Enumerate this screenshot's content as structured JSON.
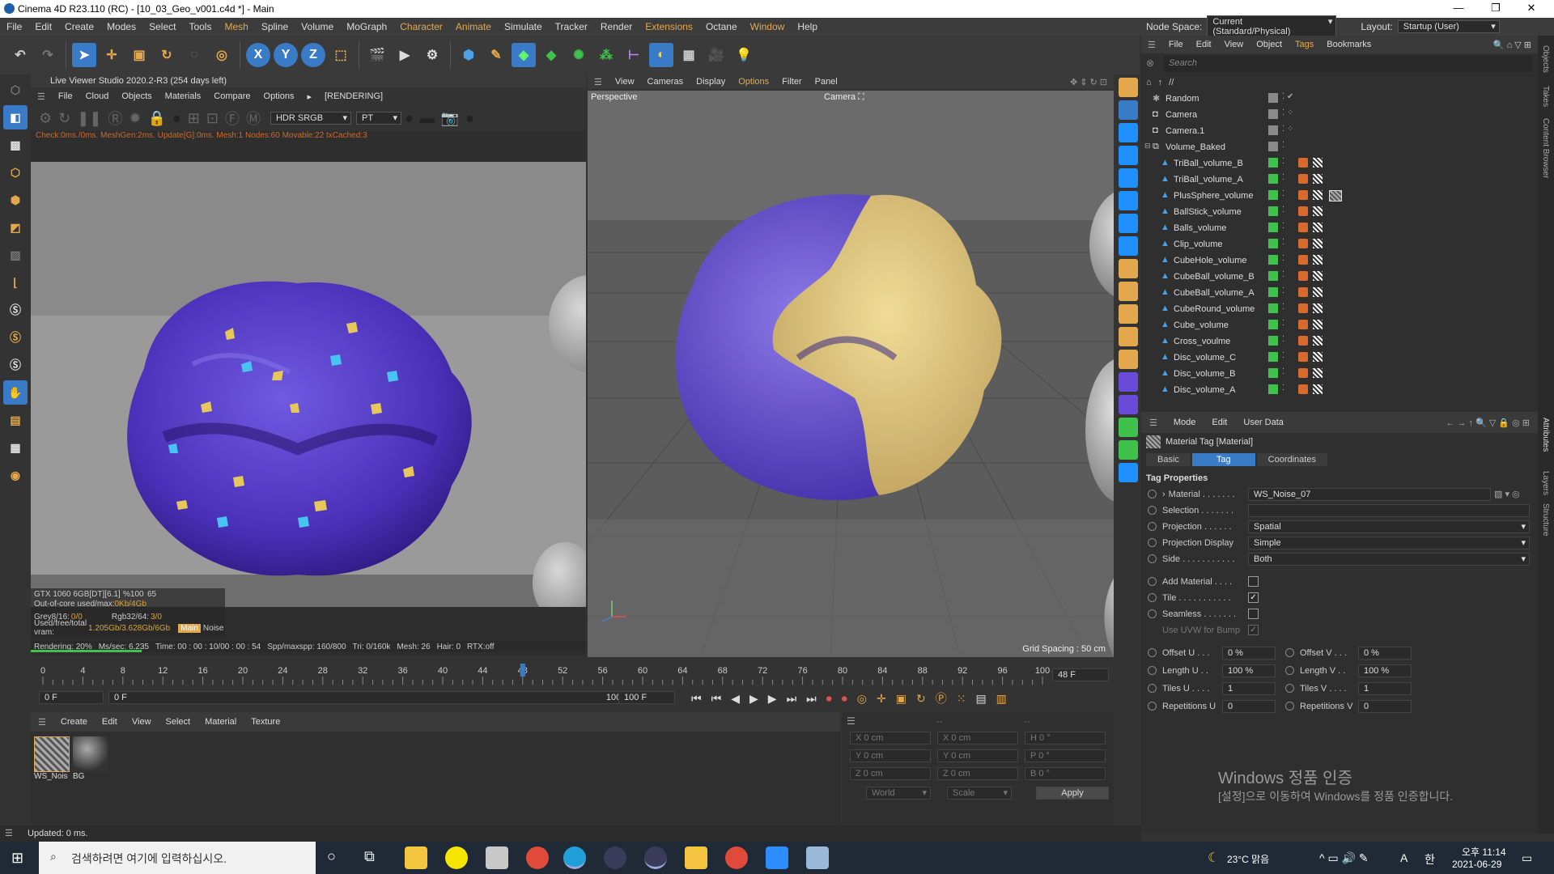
{
  "window": {
    "title": "Cinema 4D R23.110 (RC) - [10_03_Geo_v001.c4d *] - Main",
    "min": "—",
    "max": "❐",
    "close": "✕"
  },
  "menu": [
    "File",
    "Edit",
    "Create",
    "Modes",
    "Select",
    "Tools",
    "Mesh",
    "Spline",
    "Volume",
    "MoGraph",
    "Character",
    "Animate",
    "Simulate",
    "Tracker",
    "Render",
    "Extensions",
    "Octane",
    "Window",
    "Help"
  ],
  "node_space": {
    "label": "Node Space:",
    "value": "Current (Standard/Physical)",
    "layout_label": "Layout:",
    "layout_value": "Startup (User)"
  },
  "live_viewer": {
    "title": "Live Viewer Studio 2020.2-R3 (254 days left)",
    "menu": [
      "File",
      "Cloud",
      "Objects",
      "Materials",
      "Compare",
      "Options"
    ],
    "rendering": "[RENDERING]",
    "color_space": "HDR SRGB",
    "kernel": "PT",
    "status_line": "Check:0ms./0ms. MeshGen:2ms. Update[G]:0ms. Mesh:1 Nodes:60 Movable:22 txCached:3",
    "gpu": "GTX 1060 6GB[DT][6.1]",
    "gpu_pct": "%100",
    "gpu_temp": "65",
    "ooc_label": "Out-of-core used/max:",
    "ooc_val": "0Kb/4Gb",
    "grey_label": "Grey8/16:",
    "grey_val": "0/0",
    "rgb_label": "Rgb32/64:",
    "rgb_val": "3/0",
    "vram_label": "Used/free/total vram:",
    "vram_val": "1.205Gb/3.628Gb/6Gb",
    "main_tag": "Main",
    "noise_tag": "Noise",
    "bottom_rendering": "Rendering: 20%",
    "ms_sec": "Ms/sec: 6.235",
    "time": "Time: 00 : 00 : 10/00 : 00 : 54",
    "spp": "Spp/maxspp: 160/800",
    "tri": "Tri: 0/160k",
    "mesh": "Mesh: 26",
    "hair": "Hair: 0",
    "rtx": "RTX:off",
    "render_progress": 0.2
  },
  "viewport": {
    "menu": [
      "View",
      "Cameras",
      "Display",
      "Options",
      "Filter",
      "Panel"
    ],
    "label": "Perspective",
    "camera": "Camera",
    "grid_spacing": "Grid Spacing : 50 cm"
  },
  "objects": {
    "menu": [
      "File",
      "Edit",
      "View",
      "Object",
      "Tags",
      "Bookmarks"
    ],
    "search_placeholder": "Search",
    "path": "//",
    "items": [
      {
        "name": "Random",
        "level": 0
      },
      {
        "name": "Camera",
        "level": 0
      },
      {
        "name": "Camera.1",
        "level": 0
      },
      {
        "name": "Volume_Baked",
        "level": 0
      },
      {
        "name": "TriBall_volume_B",
        "level": 1
      },
      {
        "name": "TriBall_volume_A",
        "level": 1
      },
      {
        "name": "PlusSphere_volume",
        "level": 1
      },
      {
        "name": "BallStick_volume",
        "level": 1
      },
      {
        "name": "Balls_volume",
        "level": 1
      },
      {
        "name": "Clip_volume",
        "level": 1
      },
      {
        "name": "CubeHole_volume",
        "level": 1
      },
      {
        "name": "CubeBall_volume_B",
        "level": 1
      },
      {
        "name": "CubeBall_volume_A",
        "level": 1
      },
      {
        "name": "CubeRound_volume",
        "level": 1
      },
      {
        "name": "Cube_volume",
        "level": 1
      },
      {
        "name": "Cross_voulme",
        "level": 1
      },
      {
        "name": "Disc_volume_C",
        "level": 1
      },
      {
        "name": "Disc_volume_B",
        "level": 1
      },
      {
        "name": "Disc_volume_A",
        "level": 1
      }
    ]
  },
  "attributes": {
    "menu": [
      "Mode",
      "Edit",
      "User Data"
    ],
    "title": "Material Tag [Material]",
    "tabs": [
      "Basic",
      "Tag",
      "Coordinates"
    ],
    "section": "Tag Properties",
    "material_label": "Material . . . . . . .",
    "material_value": "WS_Noise_07",
    "selection_label": "Selection . . . . . . .",
    "projection_label": "Projection . . . . . .",
    "projection_value": "Spatial",
    "projection_display_label": "Projection Display",
    "projection_display_value": "Simple",
    "side_label": "Side . . . . . . . . . . .",
    "side_value": "Both",
    "add_material_label": "Add Material . . . .",
    "tile_label": "Tile . . . . . . . . . . .",
    "seamless_label": "Seamless . . . . . . .",
    "use_uvw_label": "Use UVW for Bump",
    "offset_u_label": "Offset U . . .",
    "offset_u": "0 %",
    "offset_v_label": "Offset V . . .",
    "offset_v": "0 %",
    "length_u_label": "Length U . .",
    "length_u": "100 %",
    "length_v_label": "Length V . .",
    "length_v": "100 %",
    "tiles_u_label": "Tiles U . . . .",
    "tiles_u": "1",
    "tiles_v_label": "Tiles V . . . .",
    "tiles_v": "1",
    "rep_u_label": "Repetitions U",
    "rep_u": "0",
    "rep_v_label": "Repetitions V",
    "rep_v": "0"
  },
  "timeline": {
    "ticks": [
      "0",
      "4",
      "8",
      "12",
      "16",
      "20",
      "24",
      "28",
      "32",
      "36",
      "40",
      "44",
      "48",
      "52",
      "56",
      "60",
      "64",
      "68",
      "72",
      "76",
      "80",
      "84",
      "88",
      "92",
      "96",
      "100"
    ],
    "current_frame": "48 F",
    "start": "0 F",
    "start2": "0 F",
    "end": "100 F",
    "end2": "100 F",
    "playhead": 0.48
  },
  "materials": {
    "menu": [
      "Create",
      "Edit",
      "View",
      "Select",
      "Material",
      "Texture"
    ],
    "items": [
      "WS_Nois",
      "BG"
    ]
  },
  "coords": {
    "x1": "X  0 cm",
    "x2": "X  0 cm",
    "h": "H  0 °",
    "y1": "Y  0 cm",
    "y2": "Y  0 cm",
    "p": "P  0 °",
    "z1": "Z  0 cm",
    "z2": "Z  0 cm",
    "b": "B  0 °",
    "world": "World",
    "scale": "Scale",
    "apply": "Apply"
  },
  "status": "Updated: 0 ms.",
  "activation": {
    "line1": "Windows 정품 인증",
    "line2": "[설정]으로 이동하여 Windows를 정품 인증합니다."
  },
  "taskbar": {
    "search": "검색하려면 여기에 입력하십시오.",
    "weather": "23°C  맑음",
    "time": "오후 11:14",
    "date": "2021-06-29",
    "ime": "A",
    "hangul": "한"
  },
  "side_tabs": {
    "objects": "Objects",
    "takes": "Takes",
    "content": "Content Browser",
    "attributes": "Attributes",
    "layers": "Layers",
    "structure": "Structure"
  },
  "colors": {
    "accent": "#3a7bc8",
    "orange": "#e4a84c",
    "purple": "#5b3fc4",
    "yellow": "#e2c77a"
  }
}
